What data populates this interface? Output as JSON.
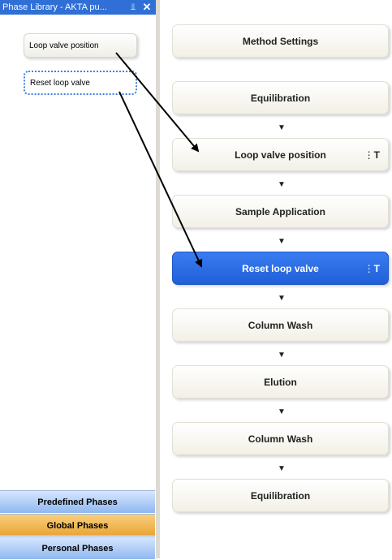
{
  "panel": {
    "title": "Phase Library - AKTA pu...",
    "pin_glyph": "⫫",
    "close_glyph": "✕",
    "items": [
      {
        "label": "Loop valve position"
      },
      {
        "label": "Reset loop valve"
      }
    ],
    "tabs": [
      {
        "label": "Predefined Phases"
      },
      {
        "label": "Global Phases"
      },
      {
        "label": "Personal Phases"
      }
    ]
  },
  "method": {
    "phases": [
      {
        "label": "Method Settings"
      },
      {
        "label": "Equilibration"
      },
      {
        "label": "Loop valve position",
        "marker": "T"
      },
      {
        "label": "Sample Application"
      },
      {
        "label": "Reset loop valve",
        "marker": "T"
      },
      {
        "label": "Column Wash"
      },
      {
        "label": "Elution"
      },
      {
        "label": "Column Wash"
      },
      {
        "label": "Equilibration"
      }
    ],
    "arrow_glyph": "▼"
  },
  "colors": {
    "title_bar": "#2f6fd6",
    "active_phase": "#2a6ee6",
    "global_tab": "#f0b54a",
    "predefined_tab": "#a9c8f3"
  }
}
